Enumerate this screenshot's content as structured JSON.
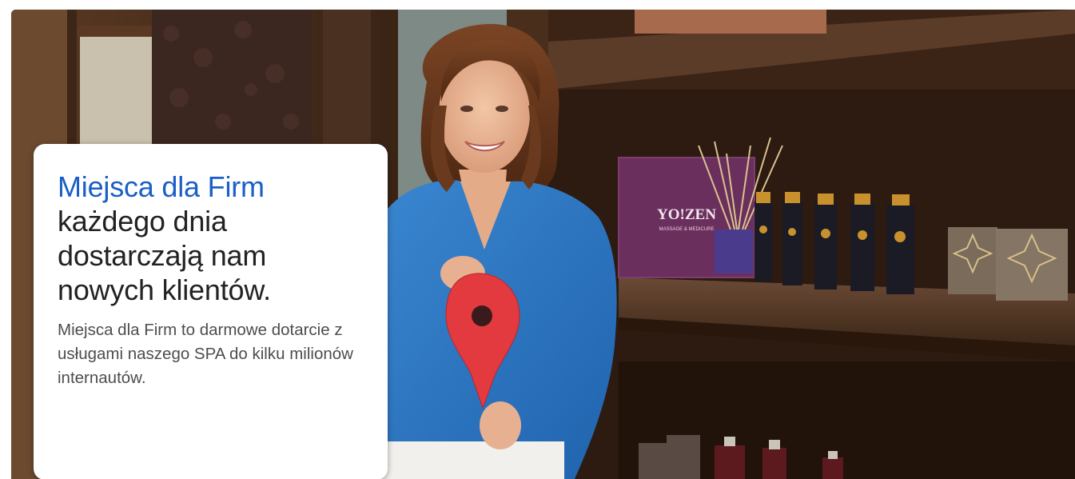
{
  "hero": {
    "headline_accent": "Miejsca dla Firm",
    "headline_rest": "każdego dnia dostarczają nam nowych klientów.",
    "body": "Miejsca dla Firm to darmowe dotarcie z usługami naszego SPA do kilku milionów internautów.",
    "bag_brand": "YO!ZEN",
    "bag_subtitle": "MASSAGE & MEDICURE"
  },
  "colors": {
    "accent_blue": "#1a5fc7",
    "headline_dark": "#222222",
    "body_gray": "#4d4d4d",
    "pin_red": "#e23a3f",
    "shirt_blue": "#2e78c4",
    "bag_purple": "#6b2f5e"
  },
  "icons": [
    "map-pin-icon"
  ]
}
